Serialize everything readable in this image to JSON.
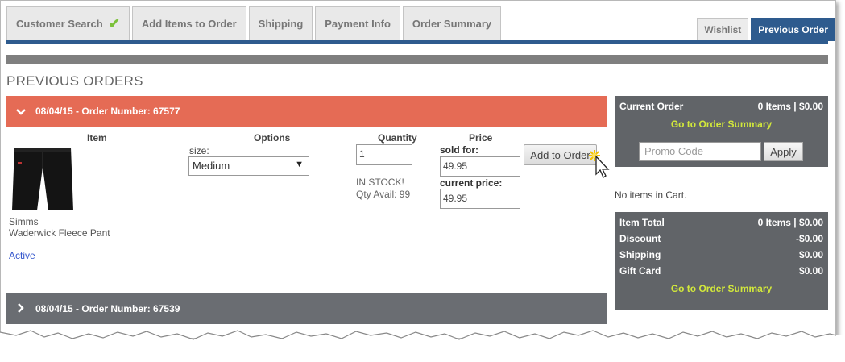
{
  "tabs": [
    {
      "label": "Customer Search",
      "completed": true
    },
    {
      "label": "Add Items to Order",
      "completed": false
    },
    {
      "label": "Shipping",
      "completed": false
    },
    {
      "label": "Payment Info",
      "completed": false
    },
    {
      "label": "Order Summary",
      "completed": false
    }
  ],
  "right_tabs": {
    "wishlist": "Wishlist",
    "previous_order": "Previous Order"
  },
  "page_title": "PREVIOUS ORDERS",
  "orders": [
    {
      "title": "08/04/15 - Order Number: 67577",
      "expanded": true
    },
    {
      "title": "08/04/15 - Order Number: 67539",
      "expanded": false
    }
  ],
  "columns": {
    "item": "Item",
    "options": "Options",
    "quantity": "Quantity",
    "price": "Price"
  },
  "item": {
    "brand": "Simms",
    "name": "Waderwick Fleece Pant",
    "status": "Active",
    "size_label": "size:",
    "size_value": "Medium",
    "quantity": "1",
    "stock_status": "IN STOCK!",
    "qty_avail": "Qty Avail: 99",
    "sold_for_label": "sold for:",
    "sold_for": "49.95",
    "current_price_label": "current price:",
    "current_price": "49.95",
    "add_button": "Add to Order"
  },
  "cart": {
    "current_order_label": "Current Order",
    "current_order_value": "0 Items | $0.00",
    "summary_link": "Go to Order Summary",
    "promo_placeholder": "Promo Code",
    "apply_label": "Apply",
    "empty_message": "No items in Cart.",
    "totals": [
      {
        "label": "Item Total",
        "value": "0 Items | $0.00"
      },
      {
        "label": "Discount",
        "value": "-$0.00"
      },
      {
        "label": "Shipping",
        "value": "$0.00"
      },
      {
        "label": "Gift Card",
        "value": "$0.00"
      }
    ],
    "summary_link_bottom": "Go to Order Summary"
  },
  "colors": {
    "accent_blue": "#2e5b8e",
    "expanded_order": "#e56b55",
    "panel_dark": "#616468",
    "link_lime": "#d2e83b",
    "check_green": "#7cc13a"
  }
}
